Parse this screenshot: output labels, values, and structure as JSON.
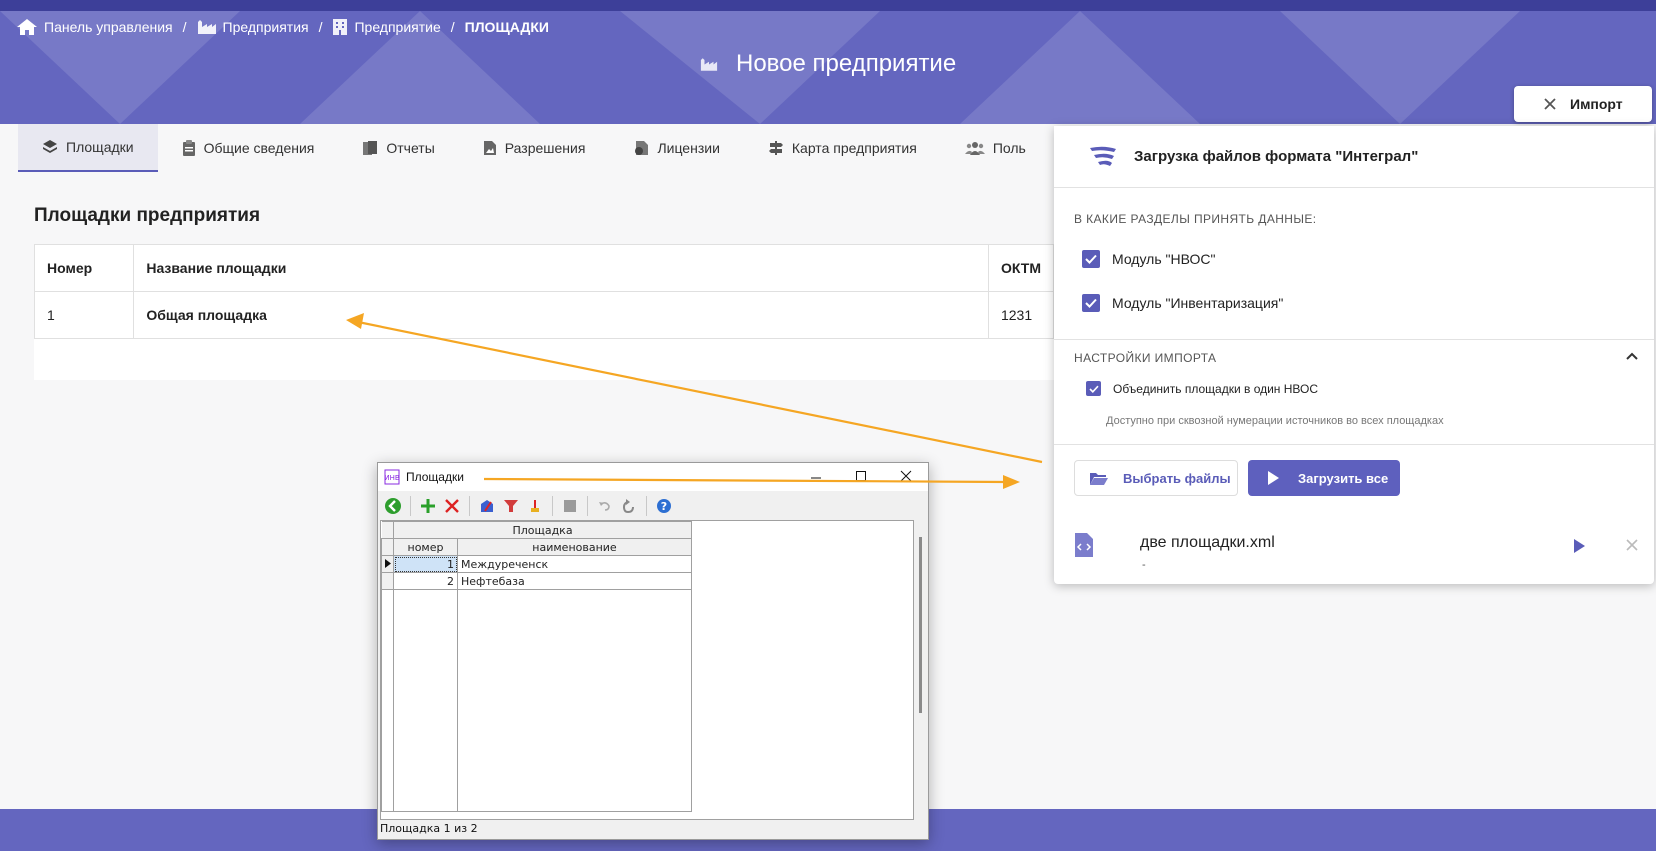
{
  "colors": {
    "brand": "#6466bf",
    "brand_dark": "#3d3f99",
    "accent": "#5a5cb8",
    "arrow": "#f5a623"
  },
  "breadcrumb": {
    "items": [
      {
        "label": "Панель управления",
        "icon": "home-icon"
      },
      {
        "label": "Предприятия",
        "icon": "factory-icon"
      },
      {
        "label": "Предприятие",
        "icon": "building-icon"
      }
    ],
    "separator": "/",
    "current": "ПЛОЩАДКИ"
  },
  "page": {
    "title": "Новое предприятие",
    "title_icon": "factory-icon"
  },
  "tabs": [
    {
      "label": "Площадки",
      "icon": "layers-icon",
      "active": true
    },
    {
      "label": "Общие сведения",
      "icon": "clipboard-icon"
    },
    {
      "label": "Отчеты",
      "icon": "documents-icon"
    },
    {
      "label": "Разрешения",
      "icon": "doc-image-icon"
    },
    {
      "label": "Лицензии",
      "icon": "license-icon"
    },
    {
      "label": "Карта предприятия",
      "icon": "signpost-icon"
    },
    {
      "label": "Поль",
      "icon": "users-icon"
    }
  ],
  "sites": {
    "title": "Площадки предприятия",
    "columns": [
      "Номер",
      "Название площадки",
      "ОКТМ"
    ],
    "rows": [
      {
        "number": "1",
        "name": "Общая площадка",
        "oktmo": "1231"
      }
    ]
  },
  "import_button": {
    "label": "Импорт",
    "icon": "close-icon"
  },
  "import_panel": {
    "title": "Загрузка файлов формата \"Интеграл\"",
    "sections_label": "В КАКИЕ РАЗДЕЛЫ ПРИНЯТЬ ДАННЫЕ:",
    "modules": [
      {
        "label": "Модуль \"НВОС\"",
        "checked": true
      },
      {
        "label": "Модуль \"Инвентаризация\"",
        "checked": true
      }
    ],
    "settings_label": "НАСТРОЙКИ ИМПОРТА",
    "merge_option": {
      "label": "Объединить площадки в один НВОС",
      "checked": true
    },
    "merge_hint": "Доступно при сквозной нумерации источников во всех площадках",
    "choose_files_label": "Выбрать файлы",
    "load_all_label": "Загрузить все",
    "file": {
      "name": "две площадки.xml",
      "status": "-"
    }
  },
  "dialog": {
    "title": "Площадки",
    "group_header": "Площадка",
    "columns": [
      "номер",
      "наименование"
    ],
    "rows": [
      {
        "number": "1",
        "name": "Междуреченск"
      },
      {
        "number": "2",
        "name": "Нефтебаза"
      }
    ],
    "status": "Площадка 1 из 2"
  }
}
